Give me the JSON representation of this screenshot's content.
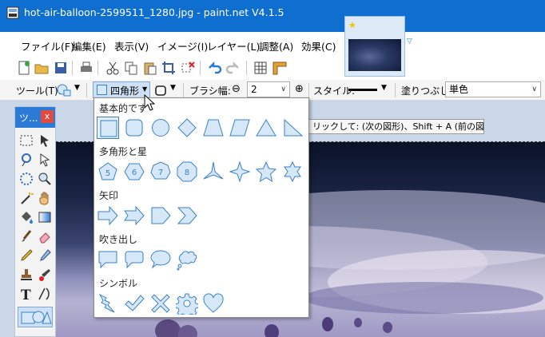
{
  "window": {
    "title": "hot-air-balloon-2599511_1280.jpg - paint.net V4.1.5"
  },
  "menu": {
    "items": [
      "ファイル(F)",
      "編集(E)",
      "表示(V)",
      "イメージ(I)",
      "レイヤー(L)",
      "調整(A)",
      "効果(C)"
    ]
  },
  "toolbar": {
    "tool_label": "ツール(T):",
    "shape_combo": "四角形",
    "brush_width_label": "ブラシ幅:",
    "brush_width_value": "2",
    "style_label": "スタイル:",
    "fill_label": "塗りつぶし:",
    "fill_value": "単色"
  },
  "tools_panel": {
    "title": "ツ...",
    "close": "x"
  },
  "tooltip": {
    "text": "リックして: (次の図形)、Shift + A (前の図形)"
  },
  "shape_menu": {
    "sections": [
      {
        "heading": "基本的です",
        "shapes": [
          "rectangle",
          "rounded-rectangle",
          "ellipse",
          "diamond",
          "trapezoid",
          "parallelogram",
          "triangle",
          "right-triangle"
        ]
      },
      {
        "heading": "多角形と星",
        "shapes": [
          "pentagon-5",
          "hexagon-6",
          "heptagon-7",
          "octagon-8",
          "three-point-star",
          "four-point-star",
          "five-point-star",
          "six-point-star"
        ]
      },
      {
        "heading": "矢印",
        "shapes": [
          "arrow",
          "chevron-arrow",
          "pentagon-arrow",
          "chevron"
        ]
      },
      {
        "heading": "吹き出し",
        "shapes": [
          "rectangle-callout",
          "rounded-callout",
          "ellipse-callout",
          "cloud-callout"
        ]
      },
      {
        "heading": "シンボル",
        "shapes": [
          "lightning",
          "checkmark",
          "x-mark",
          "gear",
          "heart"
        ]
      }
    ],
    "polygon_numbers": [
      "5",
      "6",
      "7",
      "8"
    ]
  },
  "colors": {
    "titlebar": "#0f6fd0",
    "accent": "#2b7bd6",
    "shape_fill": "#d6e8f8",
    "shape_stroke": "#3a82c7"
  }
}
